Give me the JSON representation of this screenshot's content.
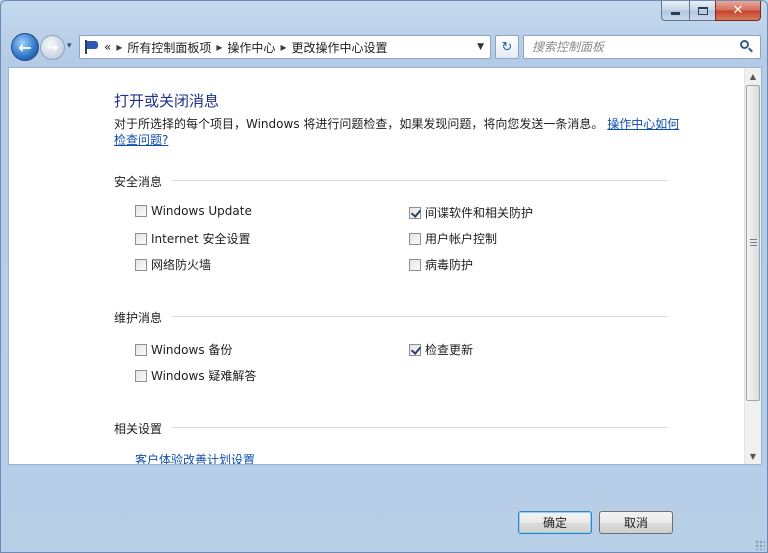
{
  "toolbar": {
    "history_glyph": "▾",
    "refresh_glyph": "↻"
  },
  "address": {
    "chevrons": "«",
    "crumbs": [
      "所有控制面板项",
      "操作中心",
      "更改操作中心设置"
    ],
    "separator": "▸",
    "dropdown_glyph": "▼"
  },
  "search": {
    "placeholder": "搜索控制面板"
  },
  "content": {
    "title": "打开或关闭消息",
    "description": "对于所选择的每个项目，Windows 将进行问题检查，如果发现问题，将向您发送一条消息。",
    "description_link": "操作中心如何检查问题?",
    "sections": {
      "security": {
        "label": "安全消息",
        "items": [
          {
            "label": "Windows Update",
            "checked": false
          },
          {
            "label": "间谍软件和相关防护",
            "checked": true
          },
          {
            "label": "Internet 安全设置",
            "checked": false
          },
          {
            "label": "用户帐户控制",
            "checked": false
          },
          {
            "label": "网络防火墙",
            "checked": false
          },
          {
            "label": "病毒防护",
            "checked": false
          }
        ]
      },
      "maintenance": {
        "label": "维护消息",
        "items": [
          {
            "label": "Windows 备份",
            "checked": false
          },
          {
            "label": "检查更新",
            "checked": true
          },
          {
            "label": "Windows 疑难解答",
            "checked": false
          }
        ]
      },
      "related": {
        "label": "相关设置",
        "link": "客户体验改善计划设置"
      }
    }
  },
  "buttons": {
    "ok": "确定",
    "cancel": "取消"
  },
  "colors": {
    "link": "#0f4fae",
    "title": "#1e3287",
    "window_frame": "#b8cfe8"
  }
}
